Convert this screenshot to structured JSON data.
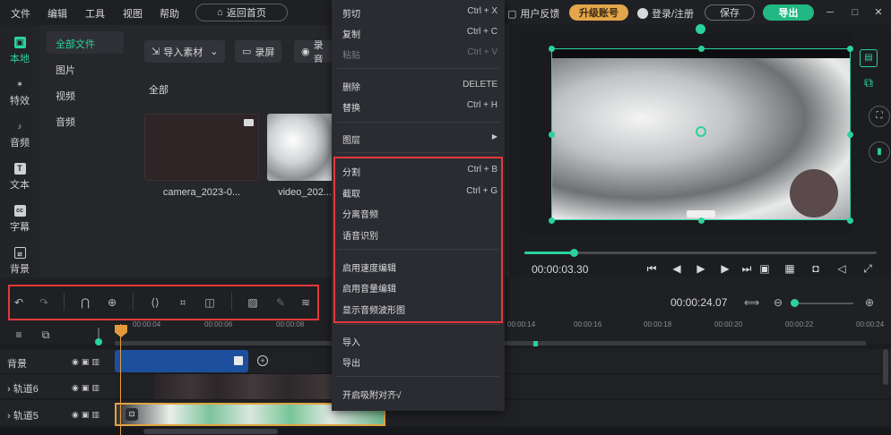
{
  "menubar": {
    "items": [
      "文件",
      "编辑",
      "工具",
      "视图",
      "帮助"
    ],
    "home_button": "返回首页",
    "feedback": "用户反馈",
    "upgrade": "升级账号",
    "login": "登录/注册",
    "save": "保存",
    "export": "导出"
  },
  "rail": {
    "items": [
      {
        "label": "本地",
        "icon": "folder-icon"
      },
      {
        "label": "特效",
        "icon": "sparkle-icon"
      },
      {
        "label": "音频",
        "icon": "music-icon"
      },
      {
        "label": "文本",
        "icon": "text-icon"
      },
      {
        "label": "字幕",
        "icon": "caption-icon"
      },
      {
        "label": "背景",
        "icon": "background-icon"
      }
    ]
  },
  "categories": [
    "全部文件",
    "图片",
    "视频",
    "音频"
  ],
  "media": {
    "import_button": "导入素材",
    "record_screen": "录屏",
    "record_audio": "录音",
    "section_title": "全部",
    "files": [
      {
        "name": "camera_2023-0..."
      },
      {
        "name": "video_202..."
      }
    ]
  },
  "preview": {
    "timecode": "00:00:03.30",
    "progress": 0.14
  },
  "toolbar": {
    "duration": "00:00:24.07"
  },
  "timeline": {
    "ticks": [
      "00:00:04",
      "00:00:06",
      "00:00:08",
      "00:00:14",
      "00:00:16",
      "00:00:18",
      "00:00:20",
      "00:00:22",
      "00:00:24"
    ],
    "tracks": [
      "背景",
      "轨道6",
      "轨道5"
    ]
  },
  "context_menu": {
    "cut": {
      "label": "剪切",
      "shortcut": "Ctrl + X"
    },
    "copy": {
      "label": "复制",
      "shortcut": "Ctrl + C"
    },
    "paste": {
      "label": "粘贴",
      "shortcut": "Ctrl + V"
    },
    "delete": {
      "label": "删除",
      "shortcut": "DELETE"
    },
    "replace": {
      "label": "替换",
      "shortcut": "Ctrl + H"
    },
    "layer": {
      "label": "图层"
    },
    "split": {
      "label": "分割",
      "shortcut": "Ctrl + B"
    },
    "trim": {
      "label": "截取",
      "shortcut": "Ctrl + G"
    },
    "detach_audio": {
      "label": "分离音频"
    },
    "speech_recognition": {
      "label": "语音识别"
    },
    "speed_edit": {
      "label": "启用速度编辑"
    },
    "volume_edit": {
      "label": "启用音量编辑"
    },
    "show_waveform": {
      "label": "显示音频波形图"
    },
    "import": {
      "label": "导入"
    },
    "export": {
      "label": "导出"
    },
    "snap": {
      "label": "开启吸附对齐√"
    }
  },
  "colors": {
    "accent": "#2bd29a",
    "upgrade": "#e3a64b",
    "highlight_box": "#e5383b",
    "bg_clip": "#1d4f9f"
  }
}
